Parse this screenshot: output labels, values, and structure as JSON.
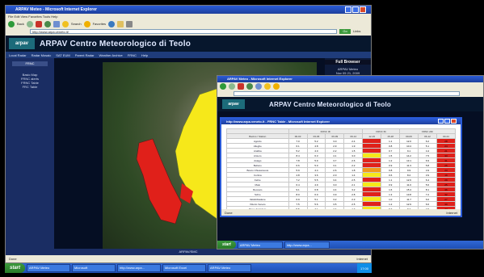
{
  "colors": {
    "alert_red": "#e0201a",
    "alert_yellow": "#f6e81a",
    "xp_blue": "#2a5bd7"
  },
  "main_window": {
    "title": "ARPAV Meteo - Microsoft Internet Explorer",
    "menu": "File  Edit  View  Favorites  Tools  Help",
    "toolbar": {
      "back": "Back",
      "search": "Search",
      "favorites": "Favorites",
      "go": "Go",
      "links": "Links"
    },
    "address": "http://www.arpa.veneto.it/",
    "site_logo": "arpav",
    "site_title": "ARPAV Centro Meteorologico di Teolo",
    "nav": [
      "Local Radar",
      "Radar Mosaic",
      "SAT EUM",
      "Parent Radar",
      "Weather Archive",
      "FRNC",
      "Help"
    ],
    "sidebar_title": "FRNC",
    "sidebar_items": [
      "Basic Map",
      "FRNC alerts",
      "FRNC Table",
      "FRC Table"
    ],
    "right_panel": {
      "title": "Full Browser",
      "lines": [
        "ARPAV Meteo",
        "Nov 05 21, 2009",
        "17:00"
      ]
    },
    "footer": "ARPAV/SMC",
    "status": {
      "left": "Done",
      "right": "Internet"
    }
  },
  "second_window": {
    "title": "ARPAV Meteo - Microsoft Internet Explorer",
    "site_logo": "arpav",
    "site_title": "ARPAV Centro Meteorologico di Teolo"
  },
  "table_window": {
    "title": "http://www.arpa.veneto.it - FRNC Table - Microsoft Internet Explorer",
    "col_groups": [
      "",
      "FRNC 3h",
      "FRNC 6h",
      "FRNC 24h"
    ],
    "headers": [
      "Bacino / Station",
      "00-03",
      "03-06",
      "06-09",
      "09-12",
      "12-15",
      "15-18",
      "00-06",
      "06-12",
      "00-24"
    ],
    "rows": [
      {
        "name": "Agordo",
        "v": [
          "7.0",
          "5.2",
          "3.0",
          "2.4",
          "",
          "1.1",
          "12.0",
          "6.2",
          "28"
        ],
        "c": [
          "",
          "",
          "",
          "",
          "r",
          "",
          "",
          "",
          "r"
        ]
      },
      {
        "name": "Alleghe",
        "v": [
          "6.1",
          "4.8",
          "2.9",
          "1.9",
          "",
          "0.8",
          "10.4",
          "5.1",
          "24"
        ],
        "c": [
          "",
          "",
          "",
          "",
          "r",
          "",
          "",
          "",
          "r"
        ]
      },
      {
        "name": "Arabba",
        "v": [
          "5.2",
          "4.0",
          "2.2",
          "1.5",
          "",
          "0.7",
          "9.1",
          "4.4",
          "21"
        ],
        "c": [
          "",
          "",
          "",
          "",
          "r",
          "",
          "",
          "",
          "r"
        ]
      },
      {
        "name": "Arsiero",
        "v": [
          "8.4",
          "6.3",
          "4.1",
          "3.0",
          "",
          "1.5",
          "14.2",
          "7.5",
          "33"
        ],
        "c": [
          "",
          "",
          "",
          "",
          "y",
          "",
          "",
          "",
          "r"
        ]
      },
      {
        "name": "Asiago",
        "v": [
          "7.8",
          "5.9",
          "3.7",
          "2.6",
          "",
          "1.2",
          "13.1",
          "6.9",
          "31"
        ],
        "c": [
          "",
          "",
          "",
          "",
          "r",
          "",
          "",
          "",
          "r"
        ]
      },
      {
        "name": "Belluno",
        "v": [
          "6.6",
          "5.0",
          "3.1",
          "2.2",
          "",
          "0.9",
          "11.3",
          "5.8",
          "26"
        ],
        "c": [
          "",
          "",
          "",
          "",
          "r",
          "",
          "",
          "",
          "r"
        ]
      },
      {
        "name": "Bosco Chiesanuova",
        "v": [
          "5.9",
          "4.4",
          "2.6",
          "1.8",
          "",
          "0.8",
          "9.9",
          "4.9",
          "23"
        ],
        "c": [
          "",
          "",
          "",
          "",
          "o",
          "",
          "",
          "",
          "r"
        ]
      },
      {
        "name": "Cortina",
        "v": [
          "4.8",
          "3.6",
          "2.0",
          "1.4",
          "",
          "0.6",
          "8.2",
          "3.9",
          "19"
        ],
        "c": [
          "",
          "",
          "",
          "",
          "y",
          "",
          "",
          "",
          "r"
        ]
      },
      {
        "name": "Feltre",
        "v": [
          "7.2",
          "5.5",
          "3.4",
          "2.5",
          "",
          "1.1",
          "12.6",
          "6.4",
          "29"
        ],
        "c": [
          "",
          "",
          "",
          "",
          "r",
          "",
          "",
          "",
          "r"
        ]
      },
      {
        "name": "Malo",
        "v": [
          "6.4",
          "4.9",
          "3.0",
          "2.1",
          "",
          "0.9",
          "11.0",
          "5.6",
          "25"
        ],
        "c": [
          "",
          "",
          "",
          "",
          "y",
          "",
          "",
          "",
          "r"
        ]
      },
      {
        "name": "Recoaro",
        "v": [
          "9.1",
          "6.8",
          "4.4",
          "3.2",
          "",
          "1.6",
          "15.4",
          "8.1",
          "36"
        ],
        "c": [
          "",
          "",
          "",
          "",
          "r",
          "",
          "",
          "",
          "r"
        ]
      },
      {
        "name": "Schio",
        "v": [
          "8.0",
          "6.0",
          "3.9",
          "2.8",
          "",
          "1.3",
          "13.8",
          "7.2",
          "32"
        ],
        "c": [
          "",
          "",
          "",
          "",
          "r",
          "",
          "",
          "",
          "r"
        ]
      },
      {
        "name": "Valdobbiadene",
        "v": [
          "6.9",
          "5.1",
          "3.2",
          "2.3",
          "",
          "1.0",
          "11.7",
          "6.0",
          "27"
        ],
        "c": [
          "",
          "",
          "",
          "",
          "y",
          "",
          "",
          "",
          "r"
        ]
      },
      {
        "name": "Vittorio Veneto",
        "v": [
          "7.5",
          "5.6",
          "3.5",
          "2.5",
          "",
          "1.2",
          "12.9",
          "6.6",
          "30"
        ],
        "c": [
          "",
          "",
          "",
          "",
          "r",
          "",
          "",
          "",
          "r"
        ]
      },
      {
        "name": "Pieve di Cadore",
        "v": [
          "5.5",
          "4.1",
          "2.4",
          "1.7",
          "",
          "0.7",
          "9.4",
          "4.6",
          "22"
        ],
        "c": [
          "",
          "",
          "",
          "",
          "y",
          "",
          "",
          "",
          "r"
        ]
      },
      {
        "name": "Sappada",
        "v": [
          "4.9",
          "3.7",
          "2.1",
          "1.5",
          "",
          "0.6",
          "8.5",
          "4.0",
          "20"
        ],
        "c": [
          "",
          "",
          "",
          "",
          "r",
          "",
          "",
          "",
          "r"
        ]
      }
    ],
    "status": {
      "left": "Done",
      "right": "Internet"
    }
  },
  "taskbar": {
    "start": "start",
    "tasks": [
      "ARPAV Meteo",
      "Microsoft",
      "http://www.arpa...",
      "Microsoft Excel",
      "ARPAV Meteo"
    ],
    "tray": "17:00"
  },
  "second_taskbar": {
    "start": "start",
    "tasks": [
      "ARPAV Meteo",
      "http://www.arpa..."
    ]
  }
}
